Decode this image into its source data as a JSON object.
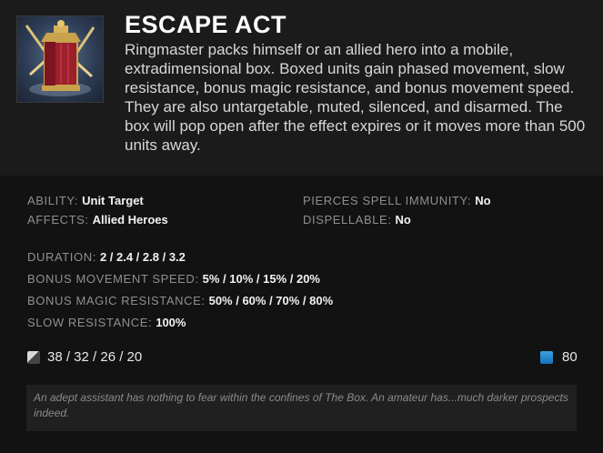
{
  "ability": {
    "name": "ESCAPE ACT",
    "icon": "escape-act-box-icon",
    "description": "Ringmaster packs himself or an allied hero into a mobile, extradimensional box. Boxed units gain phased movement, slow resistance, bonus magic resistance, and bonus movement speed. They are also untargetable, muted, silenced, and disarmed. The box will pop open after the effect expires or it moves more than 500 units away."
  },
  "properties": {
    "ability_label": "ABILITY:",
    "ability_value": "Unit Target",
    "affects_label": "AFFECTS:",
    "affects_value": "Allied Heroes",
    "pierces_label": "PIERCES SPELL IMMUNITY:",
    "pierces_value": "No",
    "dispellable_label": "DISPELLABLE:",
    "dispellable_value": "No"
  },
  "values": {
    "duration_label": "DURATION:",
    "duration_value": "2 / 2.4 / 2.8 / 3.2",
    "movespeed_label": "BONUS MOVEMENT SPEED:",
    "movespeed_value": "5% / 10% / 15% / 20%",
    "magicres_label": "BONUS MAGIC RESISTANCE:",
    "magicres_value": "50% / 60% / 70% / 80%",
    "slowres_label": "SLOW RESISTANCE:",
    "slowres_value": "100%"
  },
  "costs": {
    "cooldown": "38 / 32 / 26 / 20",
    "mana": "80"
  },
  "lore": "An adept assistant has nothing to fear within the confines of The Box. An amateur has...much darker prospects indeed.",
  "colors": {
    "background": "#121212",
    "header": "#1b1b1b",
    "mana": "#2a8ad0"
  }
}
